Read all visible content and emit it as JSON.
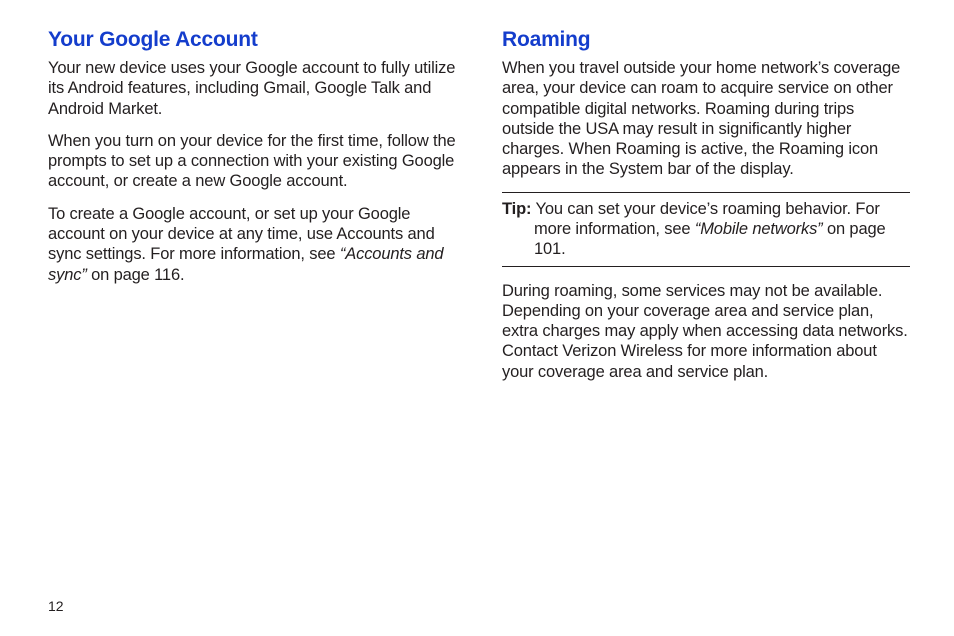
{
  "left": {
    "heading": "Your Google Account",
    "p1": "Your new device uses your Google account to fully utilize its Android features, including Gmail, Google Talk and Android Market.",
    "p2": "When you turn on your device for the first time, follow the prompts to set up a connection with your existing Google account, or create a new Google account.",
    "p3_a": "To create a Google account, or set up your Google account on your device at any time, use Accounts and sync settings. For more information, see ",
    "p3_ref": "“Accounts and sync”",
    "p3_b": " on page 116."
  },
  "right": {
    "heading": "Roaming",
    "p1": "When you travel outside your home network’s coverage area, your device can roam to acquire service on other compatible digital networks. Roaming during trips outside the USA may result in significantly higher charges. When Roaming is active, the Roaming icon appears in the System bar of the display.",
    "tip_label": "Tip:",
    "tip_a": " You can set your device’s roaming behavior. For more information, see ",
    "tip_ref": "“Mobile networks”",
    "tip_b": " on page 101.",
    "p2": "During roaming, some services may not be available. Depending on your coverage area and service plan, extra charges may apply when accessing data networks. Contact Verizon Wireless for more information about your coverage area and service plan."
  },
  "page_number": "12"
}
